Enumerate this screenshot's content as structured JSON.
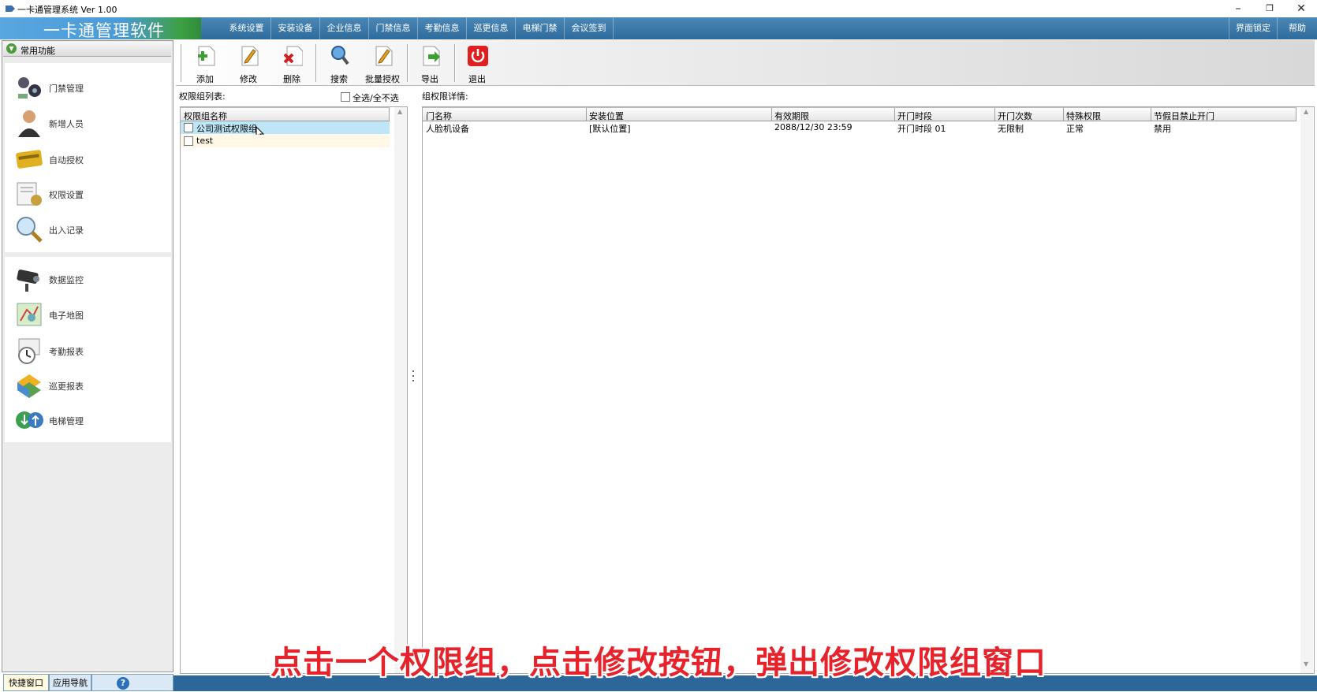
{
  "window": {
    "title": "一卡通管理系统  Ver 1.00",
    "controls": {
      "minimize": "–",
      "restore": "❐",
      "close": "✕"
    }
  },
  "logo": {
    "text": "一卡通管理软件"
  },
  "menu": {
    "items": [
      "系统设置",
      "安装设备",
      "企业信息",
      "门禁信息",
      "考勤信息",
      "巡更信息",
      "电梯门禁",
      "会议签到"
    ],
    "right_items": [
      "界面锁定",
      "帮助"
    ]
  },
  "sidebar": {
    "header": "常用功能",
    "group1": [
      "门禁管理",
      "新增人员",
      "自动授权",
      "权限设置",
      "出入记录"
    ],
    "group2": [
      "数据监控",
      "电子地图",
      "考勤报表",
      "巡更报表",
      "电梯管理"
    ],
    "bottom_tabs": [
      "快捷窗口",
      "应用导航",
      "?"
    ]
  },
  "toolbar": {
    "add": "添加",
    "edit": "修改",
    "delete": "删除",
    "search": "搜索",
    "batch": "批量授权",
    "export": "导出",
    "exit": "退出"
  },
  "groups_panel": {
    "title": "权限组列表:",
    "select_all": "全选/全不选",
    "column": "权限组名称",
    "rows": [
      "公司测试权限组",
      "test"
    ]
  },
  "detail_panel": {
    "title": "组权限详情:",
    "columns": [
      "门名称",
      "安装位置",
      "有效期限",
      "开门时段",
      "开门次数",
      "特殊权限",
      "节假日禁止开门"
    ],
    "rows": [
      [
        "人脸机设备",
        "[默认位置]",
        "2088/12/30 23:59",
        "开门时段 01",
        "无限制",
        "正常",
        "禁用"
      ]
    ]
  },
  "subtitle": "点击一个权限组，点击修改按钮，弹出修改权限组窗口",
  "colors": {
    "menu_bg": "#2f6a9a",
    "selected_row": "#bfe6f7",
    "alt_row": "#fff8e6",
    "subtitle": "#e8222a"
  }
}
